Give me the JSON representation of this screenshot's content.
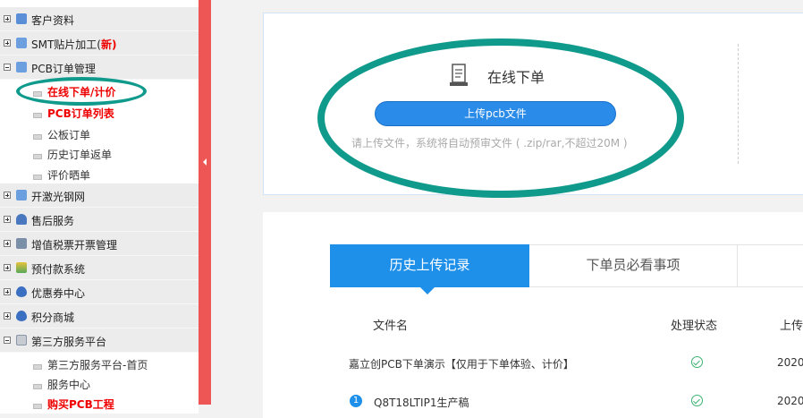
{
  "sidebar": {
    "groups": [
      {
        "label": "客户资料",
        "expanded": false
      },
      {
        "label": "SMT贴片加工(",
        "new_badge": "新",
        "suffix": ")",
        "expanded": false
      },
      {
        "label": "PCB订单管理",
        "expanded": true,
        "items": [
          "在线下单/计价",
          "PCB订单列表",
          "公板订单",
          "历史订单返单",
          "评价晒单"
        ]
      },
      {
        "label": "开激光钢网",
        "expanded": false
      },
      {
        "label": "售后服务",
        "expanded": false
      },
      {
        "label": "增值税票开票管理",
        "expanded": false
      },
      {
        "label": "预付款系统",
        "expanded": false
      },
      {
        "label": "优惠券中心",
        "expanded": false
      },
      {
        "label": "积分商城",
        "expanded": false
      },
      {
        "label": "第三方服务平台",
        "expanded": true,
        "items": [
          "第三方服务平台-首页",
          "服务中心",
          "购买PCB工程"
        ]
      }
    ]
  },
  "upload": {
    "title": "在线下单",
    "button_label": "上传pcb文件",
    "hint": "请上传文件，系统将自动预审文件 ( .zip/rar,不超过20M )"
  },
  "history": {
    "tabs": [
      "历史上传记录",
      "下单员必看事项"
    ],
    "columns": [
      "文件名",
      "处理状态",
      "上传"
    ],
    "rows": [
      {
        "index": "",
        "filename": "嘉立创PCB下单演示【仅用于下单体验、计价】",
        "status": "ok",
        "date": "2020-"
      },
      {
        "index": "1",
        "filename": "Q8T18LTIP1生产稿",
        "status": "ok",
        "date": "2020-"
      }
    ]
  },
  "colors": {
    "accent": "#1e90ea",
    "highlight_ellipse": "#109a8c",
    "red": "#e00000"
  }
}
